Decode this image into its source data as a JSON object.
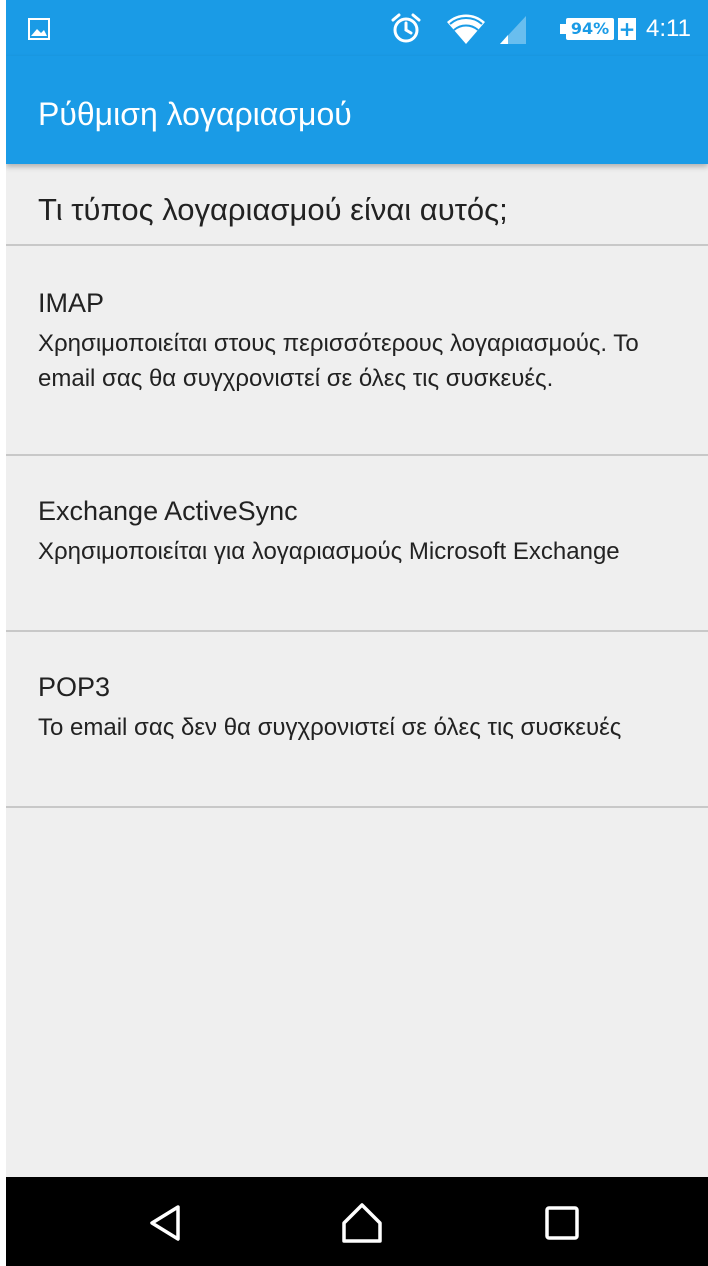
{
  "status_bar": {
    "battery_percent": "94%",
    "battery_plus": "+",
    "time": "4:11",
    "icons": [
      "image-notification-icon",
      "alarm-icon",
      "wifi-icon",
      "signal-icon",
      "battery-icon"
    ]
  },
  "app_bar": {
    "title": "Ρύθμιση λογαριασμού",
    "color": "#1a9be6"
  },
  "question": "Τι τύπος λογαριασμού είναι αυτός;",
  "options": [
    {
      "title": "IMAP",
      "description": "Χρησιμοποιείται στους περισσότερους λογαριασμούς. Το email σας θα συγχρονιστεί σε όλες τις συσκευές."
    },
    {
      "title": "Exchange ActiveSync",
      "description": "Χρησιμοποιείται για λογαριασμούς Microsoft Exchange"
    },
    {
      "title": "POP3",
      "description": "Το email σας δεν θα συγχρονιστεί σε όλες τις συσκευές"
    }
  ],
  "nav_bar": {
    "icons": [
      "back-icon",
      "home-icon",
      "recent-apps-icon"
    ]
  }
}
